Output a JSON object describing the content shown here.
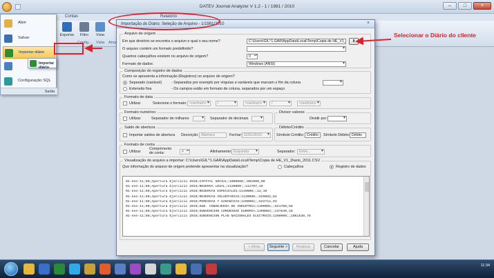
{
  "app": {
    "title": "DATEV Journal Analyzer V 1.2 - 1 / 1981 / 2010",
    "ribbon_tabs": [
      "Contas",
      "Relatório"
    ],
    "ribbon_buttons": [
      {
        "label": "Exportar",
        "color": "#2f6db5"
      },
      {
        "label": "Filtro",
        "color": "#6b7d95"
      },
      {
        "label": "Vista",
        "color": "#5d8fc9"
      }
    ],
    "ribbon_groups": [
      "Config...",
      "Vista",
      "Ama"
    ]
  },
  "app_menu": {
    "items": [
      {
        "label": "Abrir",
        "color": "#e2b04a",
        "highlighted": false
      },
      {
        "label": "Salvar",
        "color": "#3d6fb3",
        "highlighted": false
      },
      {
        "label": "Importar diário",
        "color": "#2f8f2f",
        "highlighted": true
      },
      {
        "label": "",
        "color": "#4a7fbf",
        "highlighted": false
      },
      {
        "label": "Configuração SQL",
        "color": "#2d9a9a",
        "highlighted": false
      }
    ],
    "submenu_label": "Importar diário",
    "exit_label": "Saída"
  },
  "dialog": {
    "title": "Importação do Diário: Seleção de Arquivo - 1/1981/2010",
    "close_glyph": "×",
    "origem": {
      "title": "Arquivo de origem",
      "path_question": "Em que diretório se encontra o arquivo e qual o seu nome?",
      "path_value": "C:\\Users\\GIL^1.GAR\\AppData\\Local\\Temp\\Copia de HE_V1_C",
      "format_question": "O arquivo contém um formato predefinido?",
      "header_lines_question": "Quantos cabeçalhos existem no arquivo de origem?",
      "header_lines_value": "0",
      "data_format_label": "Formato de dados:",
      "data_format_value": "Windows (ANSI)"
    },
    "registro": {
      "title": "Composição do registro de dados",
      "question": "Como se apresenta a informação (Registros) no arquivo de origem?",
      "opt_separated": "Separado (variável)",
      "opt_separated_desc": "- Separados por exemplo por vírgulas e variáveis que marcam o fim da coluna",
      "opt_fixed": "Extensão fixa",
      "opt_fixed_desc": "- Os campos estão em formato de coluna, separados por um espaço"
    },
    "data": {
      "title": "Formato de data",
      "use_label": "Utilizar",
      "select_label": "Selecione o formato:",
      "fields": [
        "<nenhum>",
        "/",
        "<nenhum>",
        "/",
        "<nenhum>"
      ]
    },
    "numerico": {
      "title": "Formato numérico",
      "use_label": "Utilizar",
      "thousands_label": "Separador de milhares",
      "decimal_label": "Separador de decimais"
    },
    "divisor": {
      "title": "Divisor valores",
      "divide_label": "Dividir por:"
    },
    "abertura": {
      "title": "Saldo de abertura",
      "import_label": "Importar saldos de abertura",
      "description_label": "Descrição:",
      "description_value": "Abertura",
      "date_label": "Fechar:",
      "date_value": "01/01/2010"
    },
    "debito_credito": {
      "title": "Débito/Crédito",
      "credit_label": "Símbolo Crédito:",
      "credit_value": "Crédito",
      "debit_label": "Símbolo Débito:",
      "debit_value": "Débito"
    },
    "conta": {
      "title": "Formato de conta",
      "use_label": "Utilizar",
      "length_label": "Comprimento de conta:",
      "length_value": "4",
      "align_label": "Alinhamento:",
      "align_value": "Esquerda",
      "separator_label": "Separador:",
      "separator_value": "Entre..."
    },
    "preview": {
      "title": "Visualização do arquivo a importar: C:\\Users\\GIL^1.GAR\\AppData\\Local\\Temp\\Copia de HE_V1_Diario_2011.CSV",
      "question": "Que informação do arquivo de origem pretende apresentar na visualização?",
      "opt_headers": "Cabeçalhos",
      "opt_records": "Registro de dados",
      "lines": [
        "01-ene-11;60;Apertura Ejercicio 2010;CAPITAL SOCIAL;1000000;;601000,00",
        "01-ene-11;60;Apertura Ejercicio 2010;RESERVA LEGAL;1120000;;111707,19",
        "01-ene-11;60;Apertura Ejercicio 2010;RESERVAS ESPECIALES;1140000;;12,10",
        "01-ene-11;60;Apertura Ejercicio 2010;RESERVAS VOLUNTARIAS;1130000;;629062,84",
        "01-ene-11;60;Apertura Ejercicio 2010;PERDIDAS Y GANANCIAS;1290001;;622711,93",
        "01-ene-11;60;Apertura Ejercicio 2010;SUB. CONSEJERIA DE INDUSTRIA;1300001;;821708,56",
        "01-ene-11;60;Apertura Ejercicio 2010;SUBVENCION COMUNIDAD EUROPEA;1300002;;237840,29",
        "01-ene-11;60;Apertura Ejercicio 2010;SUBVENCION PLAN NACIONALES ELECTRICO;1300000;;1081530,78"
      ]
    },
    "buttons": {
      "back": "< Atrás",
      "next": "Seguinte >",
      "finish": "Finalizar",
      "cancel": "Cancelar",
      "help": "Ajuda"
    }
  },
  "annotation": {
    "text": "Selecionar o Diário do cliente",
    "color": "#e0202b"
  },
  "taskbar": {
    "time": "11:34",
    "date": ""
  }
}
